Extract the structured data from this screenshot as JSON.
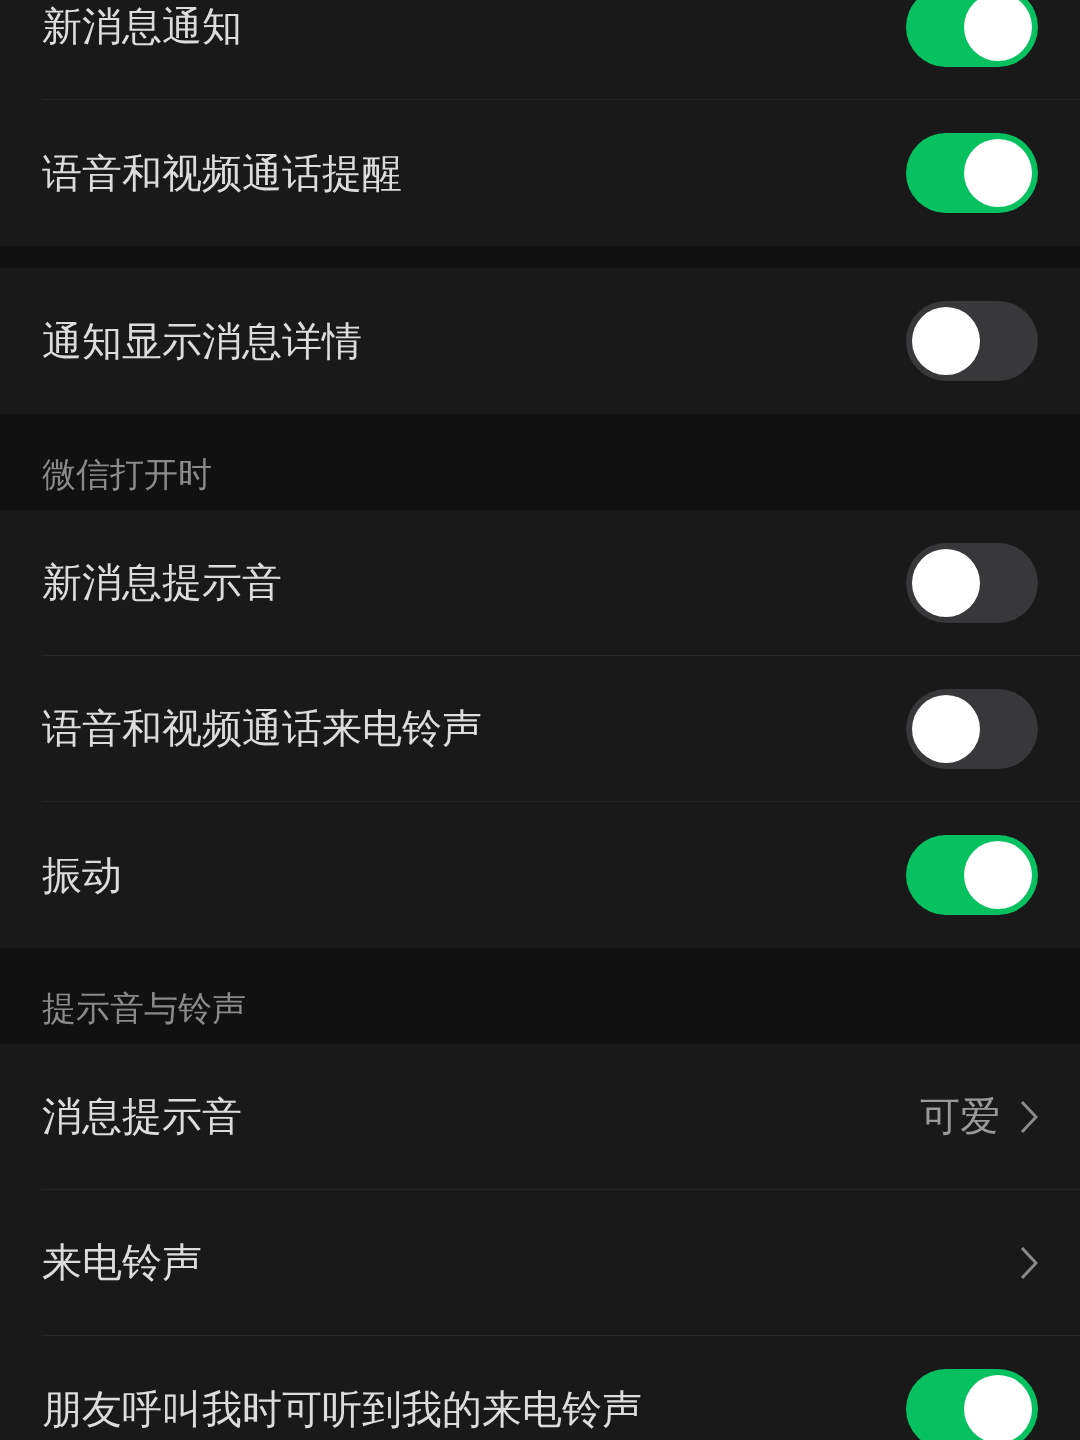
{
  "groups": [
    {
      "items": [
        {
          "kind": "toggle",
          "label": "新消息通知",
          "on": true
        },
        {
          "kind": "toggle",
          "label": "语音和视频通话提醒",
          "on": true
        }
      ]
    },
    {
      "items": [
        {
          "kind": "toggle",
          "label": "通知显示消息详情",
          "on": false
        }
      ]
    },
    {
      "header": "微信打开时",
      "items": [
        {
          "kind": "toggle",
          "label": "新消息提示音",
          "on": false
        },
        {
          "kind": "toggle",
          "label": "语音和视频通话来电铃声",
          "on": false
        },
        {
          "kind": "toggle",
          "label": "振动",
          "on": true
        }
      ]
    },
    {
      "header": "提示音与铃声",
      "items": [
        {
          "kind": "link",
          "label": "消息提示音",
          "value": "可爱"
        },
        {
          "kind": "link",
          "label": "来电铃声"
        },
        {
          "kind": "toggle",
          "label": "朋友呼叫我时可听到我的来电铃声",
          "on": true
        }
      ]
    }
  ]
}
